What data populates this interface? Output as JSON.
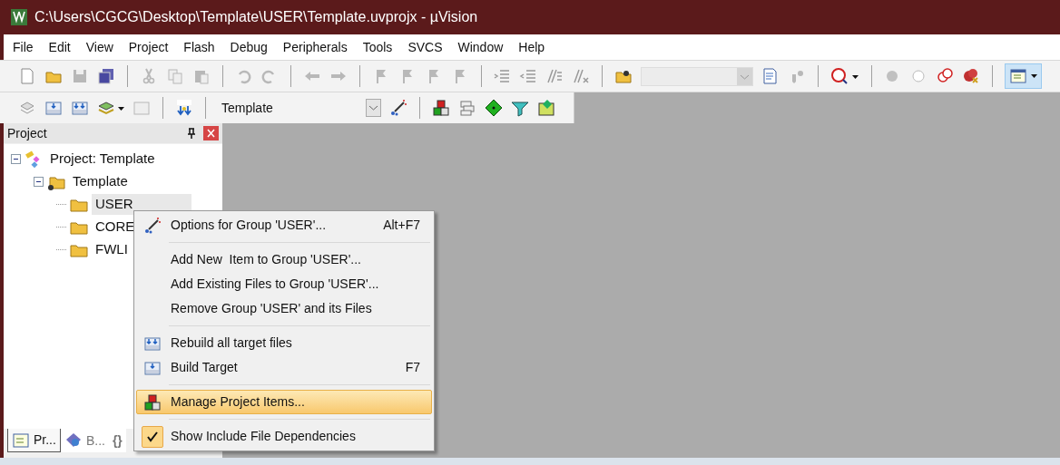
{
  "window": {
    "title": "C:\\Users\\CGCG\\Desktop\\Template\\USER\\Template.uvprojx - µVision"
  },
  "menu_bar": [
    "File",
    "Edit",
    "View",
    "Project",
    "Flash",
    "Debug",
    "Peripherals",
    "Tools",
    "SVCS",
    "Window",
    "Help"
  ],
  "build_toolbar": {
    "target_select": {
      "value": "Template"
    }
  },
  "project_panel": {
    "title": "Project",
    "tree": [
      {
        "label": "Project: Template",
        "kind": "project",
        "expanded": true,
        "selected": false,
        "children": [
          {
            "label": "Template",
            "kind": "target",
            "expanded": true,
            "selected": false,
            "children": [
              {
                "label": "USER",
                "kind": "group",
                "selected": true
              },
              {
                "label": "CORE",
                "kind": "group",
                "selected": false
              },
              {
                "label": "FWLI",
                "kind": "group",
                "selected": false
              }
            ]
          }
        ]
      }
    ],
    "tabs": [
      {
        "label": "Pr...",
        "kind": "project",
        "selected": true
      },
      {
        "label": "B...",
        "kind": "books",
        "selected": false
      },
      {
        "label": "{}",
        "kind": "functions",
        "selected": false
      }
    ]
  },
  "context_menu": [
    {
      "kind": "options",
      "label": "Options for Group 'USER'...",
      "shortcut": "Alt+F7",
      "selected": false
    },
    {
      "kind": "separator"
    },
    {
      "kind": "plain",
      "label": "Add New  Item to Group 'USER'...",
      "selected": false
    },
    {
      "kind": "plain",
      "label": "Add Existing Files to Group 'USER'...",
      "selected": false
    },
    {
      "kind": "plain",
      "label": "Remove Group 'USER' and its Files",
      "selected": false
    },
    {
      "kind": "separator"
    },
    {
      "kind": "rebuild",
      "label": "Rebuild all target files",
      "selected": false
    },
    {
      "kind": "build",
      "label": "Build Target",
      "shortcut": "F7",
      "selected": false
    },
    {
      "kind": "separator"
    },
    {
      "kind": "manage",
      "label": "Manage Project Items...",
      "selected": true
    },
    {
      "kind": "separator"
    },
    {
      "kind": "toggle",
      "label": "Show Include File Dependencies",
      "checked": true,
      "selected": false
    }
  ]
}
